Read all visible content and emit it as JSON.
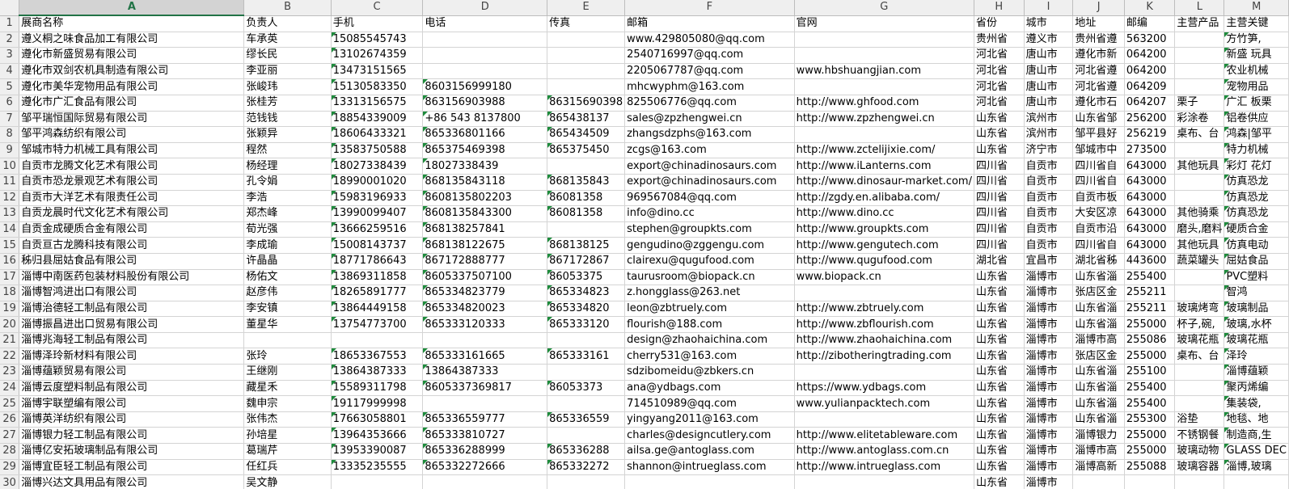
{
  "column_headers": [
    "A",
    "B",
    "C",
    "D",
    "E",
    "F",
    "G",
    "H",
    "I",
    "J",
    "K",
    "L",
    "M"
  ],
  "selected_column": "A",
  "header_row": [
    "展商名称",
    "负责人",
    "手机",
    "电话",
    "传真",
    "邮箱",
    "官网",
    "省份",
    "城市",
    "地址",
    "邮编",
    "主营产品",
    "主营关键"
  ],
  "rows": [
    {
      "num": "2",
      "cells": [
        "遵义桐之味食品加工有限公司",
        "车承英",
        "15085545743",
        "",
        "",
        "www.429805080@qq.com",
        "",
        "贵州省",
        "遵义市",
        "贵州省遵",
        "563200",
        "",
        "方竹笋,"
      ]
    },
    {
      "num": "3",
      "cells": [
        "遵化市新盛贸易有限公司",
        "缪长民",
        "13102674359",
        "",
        "",
        "2540716997@qq.com",
        "",
        "河北省",
        "唐山市",
        "遵化市新",
        "064200",
        "",
        "新盛 玩具"
      ]
    },
    {
      "num": "4",
      "cells": [
        "遵化市双剑农机具制造有限公司",
        "李亚丽",
        "13473151565",
        "",
        "",
        "2205067787@qq.com",
        "www.hbshuangjian.com",
        "河北省",
        "唐山市",
        "河北省遵",
        "064200",
        "",
        "农业机械"
      ]
    },
    {
      "num": "5",
      "cells": [
        "遵化市美华宠物用品有限公司",
        "张峻玮",
        "15130583350",
        "8603156999180",
        "",
        "mhcwyphm@163.com",
        "",
        "河北省",
        "唐山市",
        "河北省遵",
        "064209",
        "",
        "宠物用品"
      ]
    },
    {
      "num": "6",
      "cells": [
        "遵化市广汇食品有限公司",
        "张桂芳",
        "13313156575",
        "863156903988",
        "86315690398",
        "825506776@qq.com",
        "http://www.ghfood.com",
        "河北省",
        "唐山市",
        "遵化市石",
        "064207",
        "栗子",
        "广汇 板栗"
      ]
    },
    {
      "num": "7",
      "cells": [
        "邹平瑞恒国际贸易有限公司",
        "范钱钱",
        "18854339009",
        "+86 543 8137800",
        "865438137",
        "sales@zpzhengwei.cn",
        "http://www.zpzhengwei.cn",
        "山东省",
        "滨州市",
        "山东省邹",
        "256200",
        "彩涂卷",
        "铝卷供应"
      ]
    },
    {
      "num": "8",
      "cells": [
        "邹平鸿森纺织有限公司",
        "张颖异",
        "18606433321",
        "865336801166",
        "865434509",
        "zhangsdzphs@163.com",
        "",
        "山东省",
        "滨州市",
        "邹平县好",
        "256219",
        "桌布、台",
        "鸿森|邹平"
      ]
    },
    {
      "num": "9",
      "cells": [
        "邹城市特力机械工具有限公司",
        "程然",
        "13583750588",
        "865375469398",
        "865375450",
        "zcgs@163.com",
        "http://www.zctelijixie.com/",
        "山东省",
        "济宁市",
        "邹城市中",
        "273500",
        "",
        "特力机械"
      ]
    },
    {
      "num": "10",
      "cells": [
        "自贡市龙腾文化艺术有限公司",
        "杨经理",
        "18027338439",
        "18027338439",
        "",
        "export@chinadinosaurs.com",
        "http://www.iLanterns.com",
        "四川省",
        "自贡市",
        "四川省自",
        "643000",
        "其他玩具",
        "彩灯 花灯"
      ]
    },
    {
      "num": "11",
      "cells": [
        "自贡市恐龙景观艺术有限公司",
        "孔令娟",
        "18990001020",
        "868135843118",
        "868135843",
        "export@chinadinosaurs.com",
        "http://www.dinosaur-market.com/",
        "四川省",
        "自贡市",
        "四川省自",
        "643000",
        "",
        "仿真恐龙"
      ]
    },
    {
      "num": "12",
      "cells": [
        "自贡市大洋艺术有限责任公司",
        "李浩",
        "15983196933",
        "8608135802203",
        "86081358",
        "969567084@qq.com",
        "http://zgdy.en.alibaba.com/",
        "四川省",
        "自贡市",
        "自贡市板",
        "643000",
        "",
        "仿真恐龙"
      ]
    },
    {
      "num": "13",
      "cells": [
        "自贡龙晨时代文化艺术有限公司",
        "郑杰峰",
        "13990099407",
        "8608135843300",
        "86081358",
        "info@dino.cc",
        "http://www.dino.cc",
        "四川省",
        "自贡市",
        "大安区凉",
        "643000",
        "其他骑乘",
        "仿真恐龙"
      ]
    },
    {
      "num": "14",
      "cells": [
        "自贡金成硬质合金有限公司",
        "荀光强",
        "13666259516",
        "868138257841",
        "",
        "stephen@groupkts.com",
        "http://www.groupkts.com",
        "四川省",
        "自贡市",
        "自贡市沿",
        "643000",
        "磨头,磨料",
        "硬质合金"
      ]
    },
    {
      "num": "15",
      "cells": [
        "自贡亘古龙腾科技有限公司",
        "李成瑜",
        "15008143737",
        "868138122675",
        "868138125",
        "gengudino@zggengu.com",
        "http://www.gengutech.com",
        "四川省",
        "自贡市",
        "四川省自",
        "643000",
        "其他玩具",
        "仿真电动"
      ]
    },
    {
      "num": "16",
      "cells": [
        "秭归县屈姑食品有限公司",
        "许晶晶",
        "18771786643",
        "867172888777",
        "867172867",
        "clairexu@qugufood.com",
        "http://www.qugufood.com",
        "湖北省",
        "宜昌市",
        "湖北省秭",
        "443600",
        "蔬菜罐头",
        "屈姑食品"
      ]
    },
    {
      "num": "17",
      "cells": [
        "淄博中南医药包装材料股份有限公司",
        "杨佑文",
        "13869311858",
        "8605337507100",
        "86053375",
        "taurusroom@biopack.cn",
        "www.biopack.cn",
        "山东省",
        "淄博市",
        "山东省淄",
        "255400",
        "",
        "PVC塑料"
      ]
    },
    {
      "num": "18",
      "cells": [
        "淄博智鸿进出口有限公司",
        "赵彦伟",
        "18265891777",
        "865334823779",
        "865334823",
        "z.hongglass@263.net",
        "",
        "山东省",
        "淄博市",
        "张店区金",
        "255211",
        "",
        "智鸿"
      ]
    },
    {
      "num": "19",
      "cells": [
        "淄博治德轻工制品有限公司",
        "李安镇",
        "13864449158",
        "865334820023",
        "865334820",
        "leon@zbtruely.com",
        "http://www.zbtruely.com",
        "山东省",
        "淄博市",
        "山东省淄",
        "255211",
        "玻璃烤弯",
        "玻璃制品"
      ]
    },
    {
      "num": "20",
      "cells": [
        "淄博振昌进出口贸易有限公司",
        "董星华",
        "13754773700",
        "865333120333",
        "865333120",
        "flourish@188.com",
        "http://www.zbflourish.com",
        "山东省",
        "淄博市",
        "山东省淄",
        "255000",
        "杯子,碗,",
        "玻璃,水杯"
      ]
    },
    {
      "num": "21",
      "cells": [
        "淄博兆海轻工制品有限公司",
        "",
        "",
        "",
        "",
        "design@zhaohaichina.com",
        "http://www.zhaohaichina.com",
        "山东省",
        "淄博市",
        "淄博市高",
        "255086",
        "玻璃花瓶",
        "玻璃花瓶"
      ]
    },
    {
      "num": "22",
      "cells": [
        "淄博泽玲新材料有限公司",
        "张玲",
        "18653367553",
        "865333161665",
        "865333161",
        "cherry531@163.com",
        "http://zibotheringtrading.com",
        "山东省",
        "淄博市",
        "张店区金",
        "255000",
        "桌布、台",
        "泽玲"
      ]
    },
    {
      "num": "23",
      "cells": [
        "淄博蕴颖贸易有限公司",
        "王继刚",
        "13864387333",
        "13864387333",
        "",
        "sdzibomeidu@zbkers.cn",
        "",
        "山东省",
        "淄博市",
        "山东省淄",
        "255100",
        "",
        "淄博蕴颖"
      ]
    },
    {
      "num": "24",
      "cells": [
        "淄博云度塑料制品有限公司",
        "藏星禾",
        "15589311798",
        "8605337369817",
        "86053373",
        "ana@ydbags.com",
        "https://www.ydbags.com",
        "山东省",
        "淄博市",
        "山东省淄",
        "255400",
        "",
        "聚丙烯编"
      ]
    },
    {
      "num": "25",
      "cells": [
        "淄博宇联塑编有限公司",
        "魏申宗",
        "19117999998",
        "",
        "",
        "714510989@qq.com",
        "www.yulianpacktech.com",
        "山东省",
        "淄博市",
        "山东省淄",
        "255400",
        "",
        "集装袋,"
      ]
    },
    {
      "num": "26",
      "cells": [
        "淄博英洋纺织有限公司",
        "张伟杰",
        "17663058801",
        "865336559777",
        "865336559",
        "yingyang2011@163.com",
        "",
        "山东省",
        "淄博市",
        "山东省淄",
        "255300",
        "浴垫",
        "地毯、地"
      ]
    },
    {
      "num": "27",
      "cells": [
        "淄博银力轻工制品有限公司",
        "孙培星",
        "13964353666",
        "865333810727",
        "",
        "charles@designcutlery.com",
        "http://www.elitetableware.com",
        "山东省",
        "淄博市",
        "淄博银力",
        "255000",
        "不锈钢餐",
        "制造商,生"
      ]
    },
    {
      "num": "28",
      "cells": [
        "淄博亿安拓玻璃制品有限公司",
        "葛瑞芹",
        "13953390087",
        "865336288999",
        "865336288",
        "ailsa.ge@antoglass.com",
        "http://www.antoglass.com.cn",
        "山东省",
        "淄博市",
        "淄博市高",
        "255000",
        "玻璃动物",
        "GLASS DEC"
      ]
    },
    {
      "num": "29",
      "cells": [
        "淄博宜臣轻工制品有限公司",
        "任红兵",
        "13335235555",
        "865332272666",
        "865332272",
        "shannon@intrueglass.com",
        "http://www.intrueglass.com",
        "山东省",
        "淄博市",
        "淄博高新",
        "255088",
        "玻璃容器",
        "淄博,玻璃"
      ]
    },
    {
      "num": "30",
      "cells": [
        "淄博兴达文具用品有限公司",
        "吴文静",
        "",
        "",
        "",
        "",
        "",
        "山东省",
        "淄博市",
        "",
        "",
        "",
        ""
      ]
    }
  ]
}
